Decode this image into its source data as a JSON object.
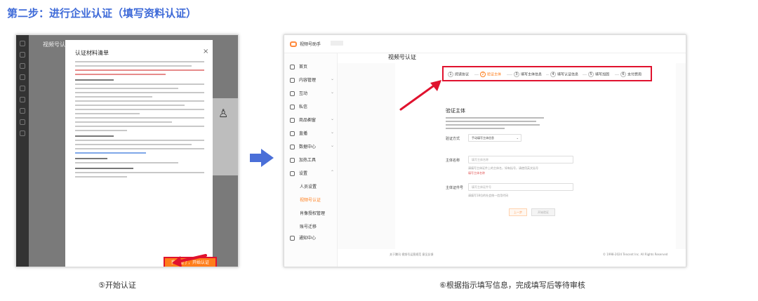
{
  "heading": "第二步：进行企业认证（填写资料认证）",
  "left": {
    "app_title": "视频号认",
    "modal_title": "认证材料清单",
    "close_glyph": "×",
    "start_button": "我知道了，开始认证",
    "caption": "⑤开始认证"
  },
  "right": {
    "app_name": "视频号助手",
    "page_title": "视频号认证",
    "sidebar": [
      {
        "label": "首页",
        "icon": "home-icon"
      },
      {
        "label": "内容管理",
        "icon": "content-icon",
        "chevron": true
      },
      {
        "label": "互动",
        "icon": "chat-icon",
        "chevron": true
      },
      {
        "label": "私信",
        "icon": "message-icon"
      },
      {
        "label": "商品橱窗",
        "icon": "shop-icon",
        "chevron": true
      },
      {
        "label": "直播",
        "icon": "live-icon",
        "chevron": true
      },
      {
        "label": "数据中心",
        "icon": "data-icon",
        "chevron": true
      },
      {
        "label": "加热工具",
        "icon": "heat-icon"
      },
      {
        "label": "设置",
        "icon": "settings-icon",
        "chevron": true
      }
    ],
    "settings_sub": [
      "人员设置",
      "视频号认证",
      "肖像授权管理",
      "账号迁移"
    ],
    "notify": "通知中心",
    "steps": [
      "阅读协议",
      "验证主体",
      "填写主体信息",
      "填写认证信息",
      "填写加固",
      "支付费用"
    ],
    "step_nums": [
      "1",
      "2",
      "3",
      "4",
      "5",
      "6"
    ],
    "active_step": 1,
    "section_title": "验证主体",
    "method_label": "验证方式",
    "method_value": "手动填写主体信息",
    "name_label": "主体名称",
    "name_placeholder": "填写主体名称",
    "name_hint": "请填写主体证件上的主体名，如有括号，请使用英文括号",
    "name_err": "填写主体名称",
    "code_label": "主体证件号",
    "code_placeholder": "填写主体证件号",
    "code_hint": "请填写18位的社会统一信用代码",
    "prev": "上一步",
    "submit": "开始验证",
    "footer": "关于腾讯    视频号运营规范    意见反馈",
    "copyright": "© 1998-2024 Tencent Inc. All Rights Reserved",
    "caption": "⑥根据指示填写信息，完成填写后等待审核"
  }
}
